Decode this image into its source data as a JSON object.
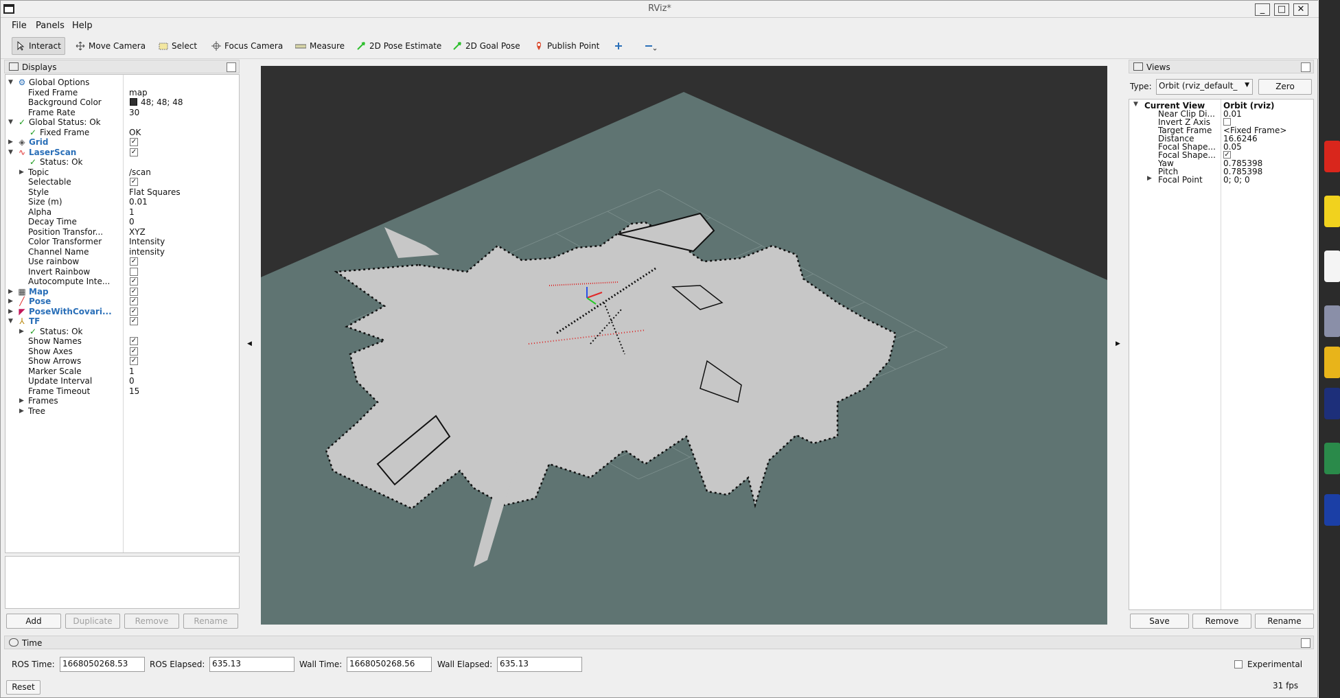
{
  "window": {
    "title": "RViz*"
  },
  "menu": [
    "File",
    "Panels",
    "Help"
  ],
  "toolbar": {
    "tools": [
      {
        "label": "Interact",
        "icon": "cursor-icon"
      },
      {
        "label": "Move Camera",
        "icon": "move-icon"
      },
      {
        "label": "Select",
        "icon": "select-icon"
      },
      {
        "label": "Focus Camera",
        "icon": "target-icon"
      },
      {
        "label": "Measure",
        "icon": "ruler-icon"
      },
      {
        "label": "2D Pose Estimate",
        "icon": "arrow-green-icon"
      },
      {
        "label": "2D Goal Pose",
        "icon": "arrow-green-icon"
      },
      {
        "label": "Publish Point",
        "icon": "pin-icon"
      }
    ]
  },
  "displays": {
    "title": "Displays",
    "rows": [
      {
        "name": "Global Options",
        "value": ""
      },
      {
        "name": "Fixed Frame",
        "value": "map"
      },
      {
        "name": "Background Color",
        "value": "48; 48; 48"
      },
      {
        "name": "Frame Rate",
        "value": "30"
      },
      {
        "name": "Global Status: Ok",
        "value": ""
      },
      {
        "name": "Fixed Frame",
        "value": "OK"
      },
      {
        "name": "Grid",
        "value": ""
      },
      {
        "name": "LaserScan",
        "value": ""
      },
      {
        "name": "Status: Ok",
        "value": ""
      },
      {
        "name": "Topic",
        "value": "/scan"
      },
      {
        "name": "Selectable",
        "value": ""
      },
      {
        "name": "Style",
        "value": "Flat Squares"
      },
      {
        "name": "Size (m)",
        "value": "0.01"
      },
      {
        "name": "Alpha",
        "value": "1"
      },
      {
        "name": "Decay Time",
        "value": "0"
      },
      {
        "name": "Position Transfor...",
        "value": "XYZ"
      },
      {
        "name": "Color Transformer",
        "value": "Intensity"
      },
      {
        "name": "Channel Name",
        "value": "intensity"
      },
      {
        "name": "Use rainbow",
        "value": ""
      },
      {
        "name": "Invert Rainbow",
        "value": ""
      },
      {
        "name": "Autocompute Inte...",
        "value": ""
      },
      {
        "name": "Map",
        "value": ""
      },
      {
        "name": "Pose",
        "value": ""
      },
      {
        "name": "PoseWithCovari...",
        "value": ""
      },
      {
        "name": "TF",
        "value": ""
      },
      {
        "name": "Status: Ok",
        "value": ""
      },
      {
        "name": "Show Names",
        "value": ""
      },
      {
        "name": "Show Axes",
        "value": ""
      },
      {
        "name": "Show Arrows",
        "value": ""
      },
      {
        "name": "Marker Scale",
        "value": "1"
      },
      {
        "name": "Update Interval",
        "value": "0"
      },
      {
        "name": "Frame Timeout",
        "value": "15"
      },
      {
        "name": "Frames",
        "value": ""
      },
      {
        "name": "Tree",
        "value": ""
      }
    ],
    "buttons": [
      "Add",
      "Duplicate",
      "Remove",
      "Rename"
    ],
    "background_swatch": "#303030"
  },
  "views": {
    "title": "Views",
    "type_label": "Type:",
    "type_value": "Orbit (rviz_default_",
    "zero_label": "Zero",
    "rows": [
      {
        "name": "Current View",
        "value": "Orbit (rviz)"
      },
      {
        "name": "Near Clip Di...",
        "value": "0.01"
      },
      {
        "name": "Invert Z Axis",
        "value": ""
      },
      {
        "name": "Target Frame",
        "value": "<Fixed Frame>"
      },
      {
        "name": "Distance",
        "value": "16.6246"
      },
      {
        "name": "Focal Shape...",
        "value": "0.05"
      },
      {
        "name": "Focal Shape...",
        "value": ""
      },
      {
        "name": "Yaw",
        "value": "0.785398"
      },
      {
        "name": "Pitch",
        "value": "0.785398"
      },
      {
        "name": "Focal Point",
        "value": "0; 0; 0"
      }
    ],
    "buttons": [
      "Save",
      "Remove",
      "Rename"
    ]
  },
  "time": {
    "title": "Time",
    "ros_time_label": "ROS Time:",
    "ros_time": "1668050268.53",
    "ros_elapsed_label": "ROS Elapsed:",
    "ros_elapsed": "635.13",
    "wall_time_label": "Wall Time:",
    "wall_time": "1668050268.56",
    "wall_elapsed_label": "Wall Elapsed:",
    "wall_elapsed": "635.13",
    "experimental_label": "Experimental",
    "reset_label": "Reset",
    "fps": "31 fps"
  },
  "colors": {
    "viewport_bg": "#303030",
    "grid_plane": "#5f7472",
    "map_free": "#c8c8c8",
    "link_blue": "#2a6fb8",
    "status_green": "#1a9a1a"
  }
}
